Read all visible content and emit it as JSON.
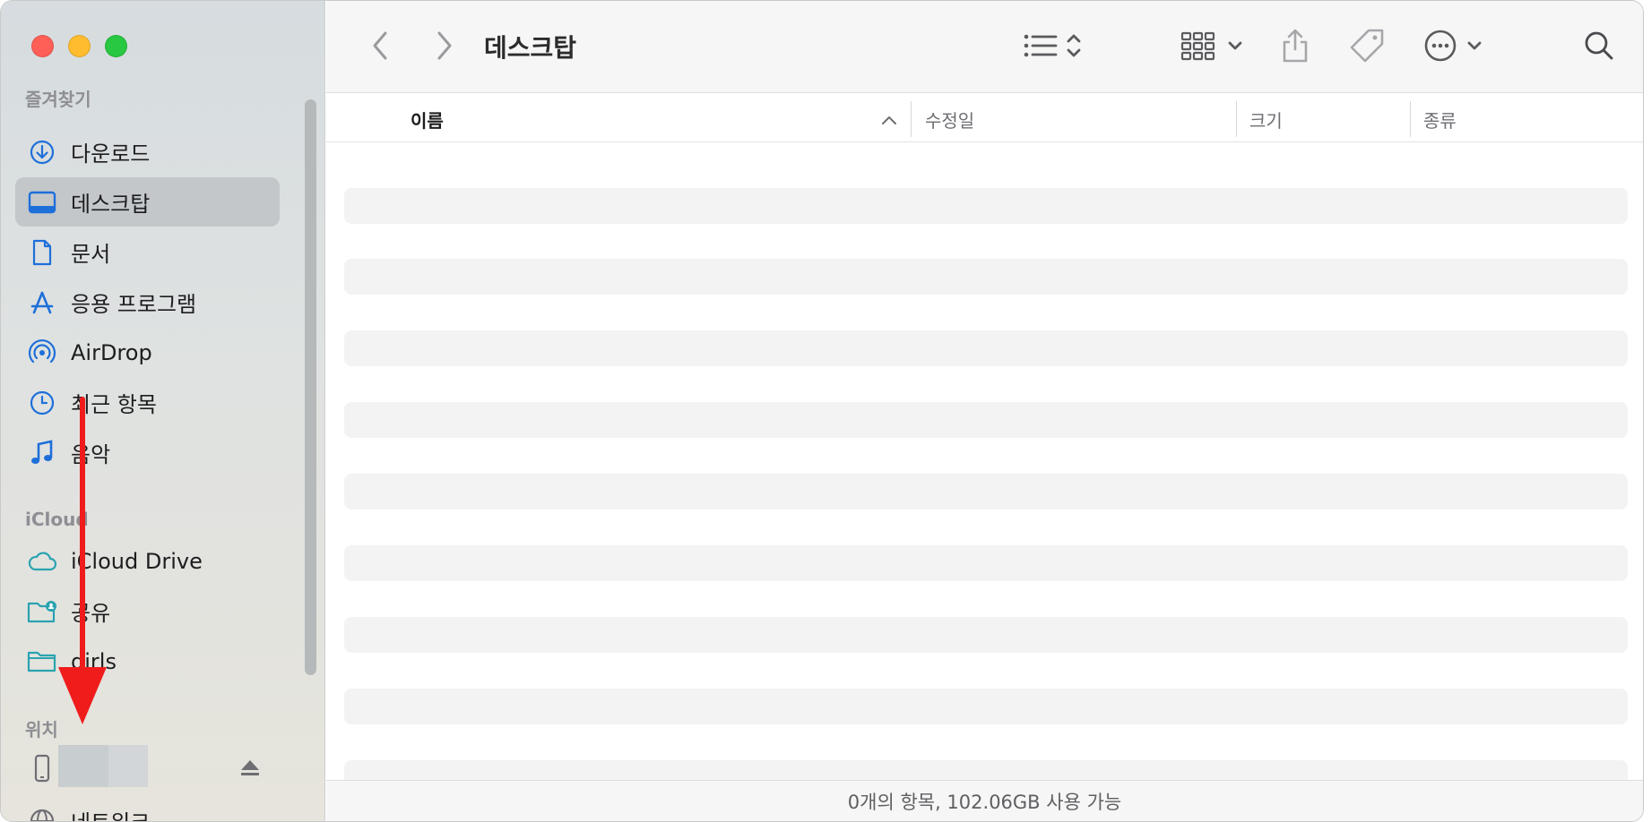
{
  "window": {
    "path_title": "데스크탑"
  },
  "sidebar": {
    "sections": {
      "favorites": "즐겨찾기",
      "icloud": "iCloud",
      "locations": "위치"
    },
    "favorites": [
      {
        "label": "다운로드",
        "icon": "download-circle-icon"
      },
      {
        "label": "데스크탑",
        "icon": "desktop-icon",
        "selected": true
      },
      {
        "label": "문서",
        "icon": "document-icon"
      },
      {
        "label": "응용 프로그램",
        "icon": "applications-icon"
      },
      {
        "label": "AirDrop",
        "icon": "airdrop-icon"
      },
      {
        "label": "최근 항목",
        "icon": "clock-icon"
      },
      {
        "label": "음악",
        "icon": "music-note-icon"
      }
    ],
    "icloud_items": [
      {
        "label": "iCloud Drive",
        "icon": "cloud-icon"
      },
      {
        "label": "공유",
        "icon": "shared-folder-icon"
      },
      {
        "label": "girls",
        "icon": "folder-icon"
      }
    ],
    "locations_items": [
      {
        "label": "",
        "icon": "iphone-icon"
      },
      {
        "label": "네트워크",
        "icon": "globe-icon"
      }
    ]
  },
  "columns": {
    "name": "이름",
    "modified": "수정일",
    "size": "크기",
    "kind": "종류"
  },
  "status": {
    "text": "0개의 항목, 102.06GB 사용 가능"
  },
  "colors": {
    "accent": "#1e6fd9",
    "annotation_arrow": "#f01c1c",
    "close": "#fe5f57",
    "minimize": "#febc2e",
    "zoom": "#28c840"
  }
}
